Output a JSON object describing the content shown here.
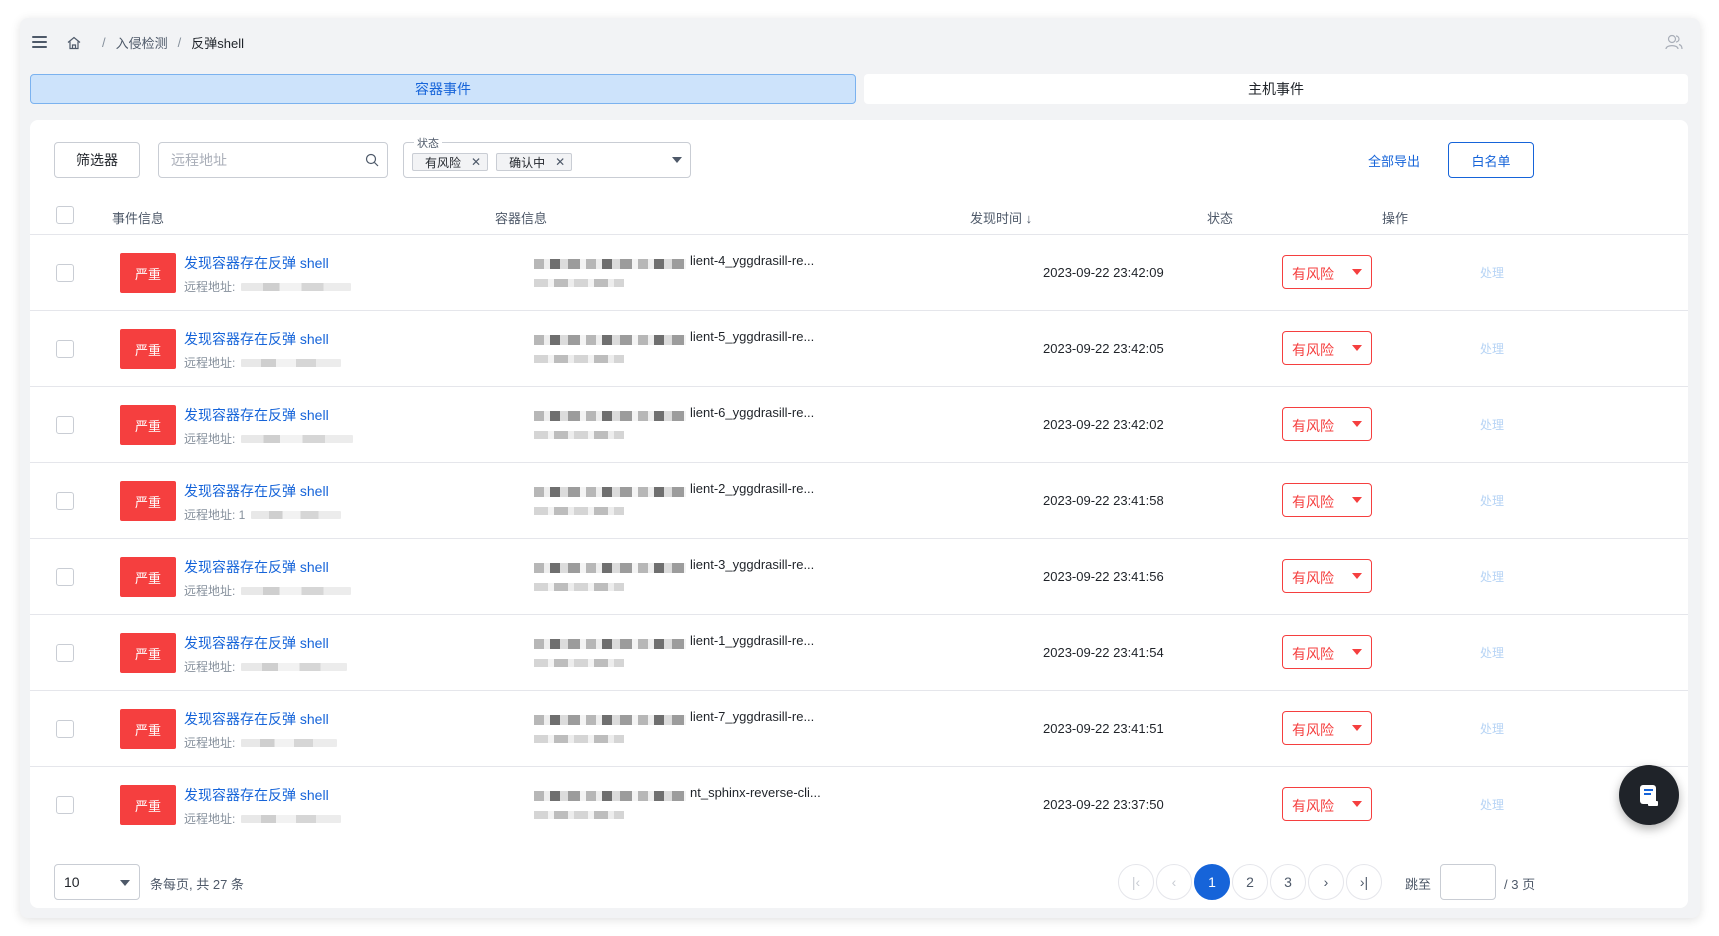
{
  "breadcrumb": {
    "level1": "入侵检测",
    "current": "反弹shell",
    "separator": "/"
  },
  "tabs": [
    {
      "label": "容器事件",
      "active": true
    },
    {
      "label": "主机事件",
      "active": false
    }
  ],
  "toolbar": {
    "filter_label": "筛选器",
    "search_placeholder": "远程地址",
    "status_field_label": "状态",
    "status_tags": [
      "有风险",
      "确认中"
    ],
    "export_label": "全部导出",
    "whitelist_label": "白名单"
  },
  "table": {
    "headers": {
      "event": "事件信息",
      "container": "容器信息",
      "time": "发现时间 ↓",
      "status": "状态",
      "action": "操作"
    },
    "rows": [
      {
        "severity": "严重",
        "title": "发现容器存在反弹 shell",
        "remote_label": "远程地址:",
        "container": "lient-4_yggdrasill-re...",
        "time": "2023-09-22 23:42:09",
        "status": "有风险",
        "action": "处理"
      },
      {
        "severity": "严重",
        "title": "发现容器存在反弹 shell",
        "remote_label": "远程地址:",
        "container": "lient-5_yggdrasill-re...",
        "time": "2023-09-22 23:42:05",
        "status": "有风险",
        "action": "处理"
      },
      {
        "severity": "严重",
        "title": "发现容器存在反弹 shell",
        "remote_label": "远程地址:",
        "container": "lient-6_yggdrasill-re...",
        "time": "2023-09-22 23:42:02",
        "status": "有风险",
        "action": "处理"
      },
      {
        "severity": "严重",
        "title": "发现容器存在反弹 shell",
        "remote_label": "远程地址: 1",
        "container": "lient-2_yggdrasill-re...",
        "time": "2023-09-22 23:41:58",
        "status": "有风险",
        "action": "处理"
      },
      {
        "severity": "严重",
        "title": "发现容器存在反弹 shell",
        "remote_label": "远程地址:",
        "container": "lient-3_yggdrasill-re...",
        "time": "2023-09-22 23:41:56",
        "status": "有风险",
        "action": "处理"
      },
      {
        "severity": "严重",
        "title": "发现容器存在反弹 shell",
        "remote_label": "远程地址:",
        "container": "lient-1_yggdrasill-re...",
        "time": "2023-09-22 23:41:54",
        "status": "有风险",
        "action": "处理"
      },
      {
        "severity": "严重",
        "title": "发现容器存在反弹 shell",
        "remote_label": "远程地址:",
        "container": "lient-7_yggdrasill-re...",
        "time": "2023-09-22 23:41:51",
        "status": "有风险",
        "action": "处理"
      },
      {
        "severity": "严重",
        "title": "发现容器存在反弹 shell",
        "remote_label": "远程地址:",
        "container": "nt_sphinx-reverse-cli...",
        "time": "2023-09-22 23:37:50",
        "status": "有风险",
        "action": "处理"
      }
    ]
  },
  "pagination": {
    "page_size": "10",
    "total_text": "条每页, 共 27 条",
    "pages": [
      "1",
      "2",
      "3"
    ],
    "current_page": "1",
    "jump_label": "跳至",
    "total_pages_text": "/ 3 页"
  },
  "colors": {
    "accent": "#1664d9",
    "danger": "#f53f3f"
  }
}
